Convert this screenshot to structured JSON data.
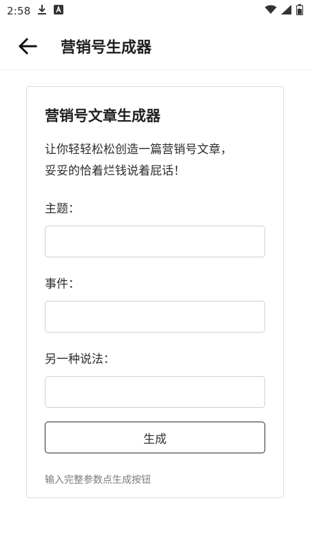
{
  "status_bar": {
    "time": "2:58",
    "icons": [
      "download-icon",
      "a-icon",
      "wifi-icon",
      "signal-icon",
      "battery-icon"
    ]
  },
  "app_bar": {
    "back_icon": "back-arrow-icon",
    "title": "营销号生成器"
  },
  "card": {
    "title": "营销号文章生成器",
    "description_line1": "让你轻轻松松创造一篇营销号文章，",
    "description_line2": "妥妥的恰着烂钱说着屁话！",
    "fields": [
      {
        "label": "主题：",
        "value": "",
        "placeholder": ""
      },
      {
        "label": "事件：",
        "value": "",
        "placeholder": ""
      },
      {
        "label": "另一种说法：",
        "value": "",
        "placeholder": ""
      }
    ],
    "generate_label": "生成",
    "hint": "输入完整参数点生成按钮"
  }
}
